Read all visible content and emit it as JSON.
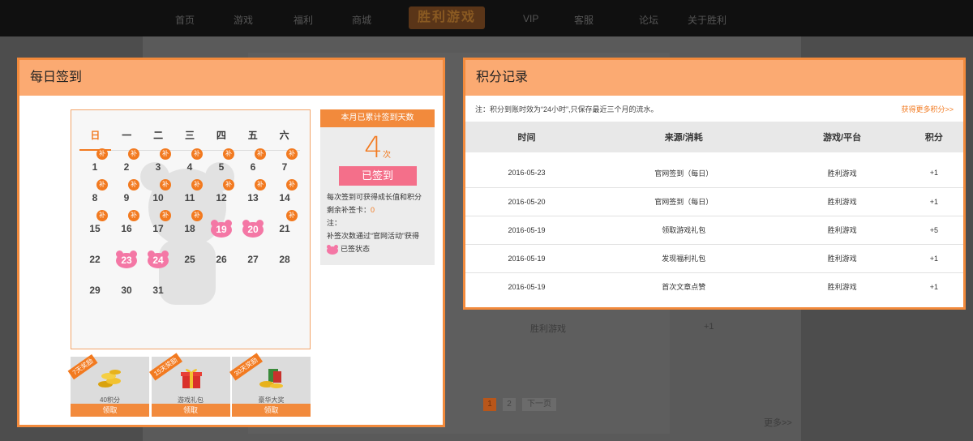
{
  "topnav": {
    "items": [
      "首页",
      "游戏",
      "福利",
      "商城",
      "VIP",
      "客服",
      "论坛",
      "关于胜利"
    ],
    "logo": "胜利游戏"
  },
  "background": {
    "ghost_texts": [
      "胜利游戏",
      "+1",
      "更多>>"
    ],
    "pager": [
      "1",
      "2",
      "下一页"
    ]
  },
  "checkin": {
    "title": "每日签到",
    "weekdays": [
      "日",
      "一",
      "二",
      "三",
      "四",
      "五",
      "六"
    ],
    "bu_label": "补",
    "days": [
      "1",
      "2",
      "3",
      "4",
      "5",
      "6",
      "7",
      "8",
      "9",
      "10",
      "11",
      "12",
      "13",
      "14",
      "15",
      "16",
      "17",
      "18",
      "19",
      "20",
      "21",
      "22",
      "23",
      "24",
      "25",
      "26",
      "27",
      "28",
      "29",
      "30",
      "31"
    ],
    "signed_days": [
      "19",
      "20",
      "23",
      "24"
    ],
    "stats": {
      "header": "本月已累计签到天数",
      "count": "4",
      "unit": "次",
      "button": "已签到",
      "note1": "每次签到可获得成长值和积分",
      "remaining_label": "剩余补签卡：",
      "remaining_value": "0",
      "note_label": "注：",
      "note2": "补签次数通过“官网活动”获得",
      "legend": "已签状态"
    },
    "rewards": [
      {
        "ribbon": "7天奖励",
        "name": "40积分",
        "claim": "领取"
      },
      {
        "ribbon": "15天奖励",
        "name": "游戏礼包",
        "claim": "领取"
      },
      {
        "ribbon": "30天奖励",
        "name": "豪华大奖",
        "claim": "领取"
      }
    ]
  },
  "points": {
    "title": "积分记录",
    "notice": "注：积分到账时效为“24小时”,只保存最近三个月的流水。",
    "more_link": "获得更多积分>>",
    "columns": [
      "时间",
      "来源/消耗",
      "游戏/平台",
      "积分"
    ],
    "rows": [
      {
        "time": "2016-05-23",
        "source": "官网签到（每日）",
        "platform": "胜利游戏",
        "points": "+1"
      },
      {
        "time": "2016-05-20",
        "source": "官网签到（每日）",
        "platform": "胜利游戏",
        "points": "+1"
      },
      {
        "time": "2016-05-19",
        "source": "领取游戏礼包",
        "platform": "胜利游戏",
        "points": "+5"
      },
      {
        "time": "2016-05-19",
        "source": "发现福利礼包",
        "platform": "胜利游戏",
        "points": "+1"
      },
      {
        "time": "2016-05-19",
        "source": "首次文章点赞",
        "platform": "胜利游戏",
        "points": "+1"
      }
    ]
  },
  "colors": {
    "accent": "#f27a20",
    "header_bg": "#fbaa72",
    "signed_pink": "#f477a5",
    "signed_button": "#f46f8a"
  }
}
